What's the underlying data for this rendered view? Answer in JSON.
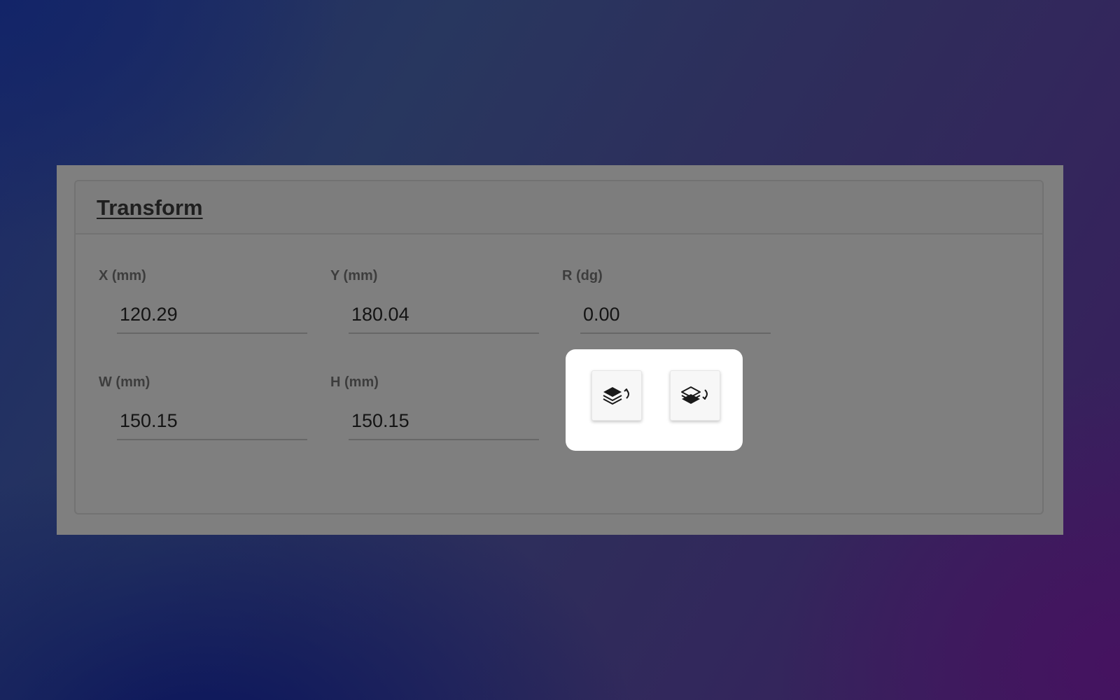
{
  "panel": {
    "title": "Transform"
  },
  "fields": {
    "x": {
      "label": "X (mm)",
      "value": "120.29"
    },
    "y": {
      "label": "Y (mm)",
      "value": "180.04"
    },
    "r": {
      "label": "R (dg)",
      "value": "0.00"
    },
    "w": {
      "label": "W (mm)",
      "value": "150.15"
    },
    "h": {
      "label": "H (mm)",
      "value": "150.15"
    }
  },
  "layer_actions": [
    {
      "name": "bring-forward",
      "icon": "layers-up-icon"
    },
    {
      "name": "send-backward",
      "icon": "layers-down-icon"
    }
  ],
  "colors": {
    "overlay": "#7f7f7f",
    "title": "#1f1f1f",
    "label": "#3d3d3d",
    "value": "#141414",
    "icon": "#1a1a1a"
  }
}
